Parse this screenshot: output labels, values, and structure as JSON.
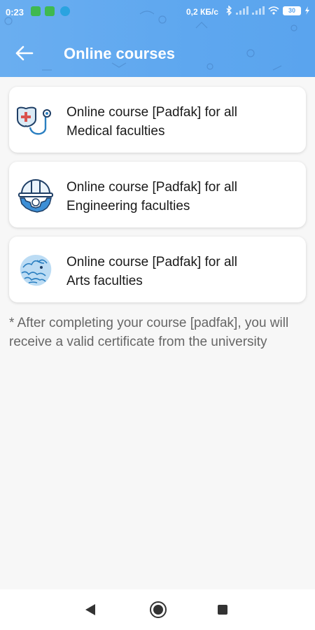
{
  "status_bar": {
    "time": "0:23",
    "speed": "0,2 КБ/с",
    "battery": "30"
  },
  "toolbar": {
    "title": "Online courses"
  },
  "courses": [
    {
      "line1": "Online course [Padfak] for all",
      "line2": "Medical faculties",
      "icon": "medical-stethoscope-icon"
    },
    {
      "line1": "Online course [Padfak] for all",
      "line2": "Engineering faculties",
      "icon": "engineering-helmet-gear-icon"
    },
    {
      "line1": "Online course [Padfak] for all",
      "line2": "Arts faculties",
      "icon": "arts-lion-icon"
    }
  ],
  "note": "* After completing your course [padfak], you will receive a valid certificate from the university",
  "colors": {
    "header": "#5ea7ef",
    "icon_blue": "#2a7fc1",
    "background": "#f7f7f7"
  }
}
